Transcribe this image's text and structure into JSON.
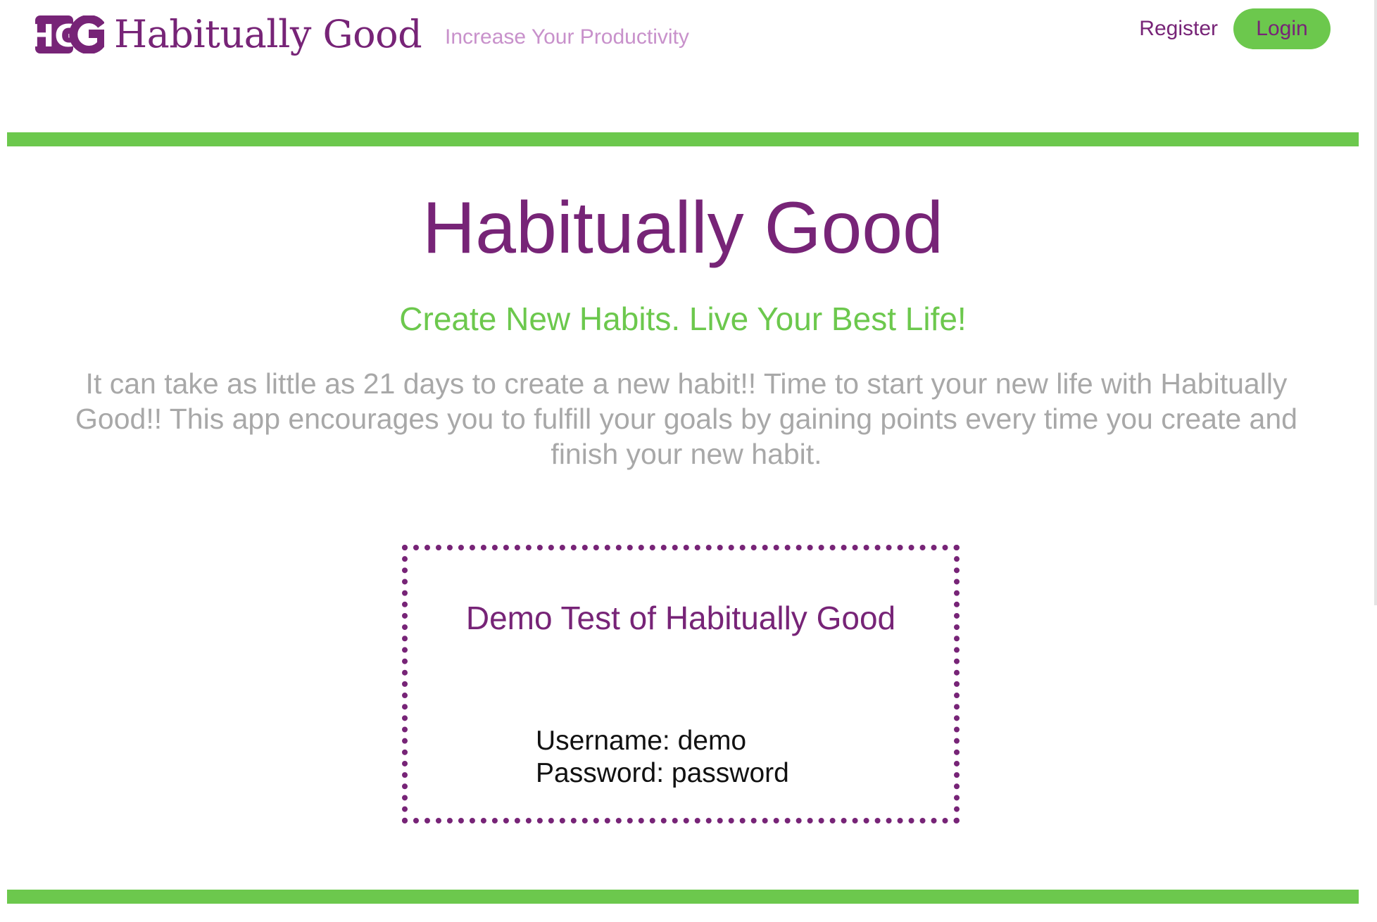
{
  "header": {
    "logo_text": "HG",
    "brand_name": "Habitually Good",
    "tagline": "Increase Your Productivity",
    "nav": {
      "register_label": "Register",
      "login_label": "Login"
    }
  },
  "hero": {
    "title": "Habitually Good",
    "subtitle": "Create New Habits. Live Your Best Life!",
    "description": "It can take as little as 21 days to create a new habit!! Time to start your new life with Habitually Good!! This app encourages you to fulfill your goals by gaining points every time you create and finish your new habit."
  },
  "demo": {
    "title": "Demo Test of Habitually Good",
    "username_line": "Username: demo",
    "password_line": "Password: password"
  },
  "colors": {
    "brand_purple": "#772477",
    "accent_green": "#6cc84d",
    "tagline_lilac": "#c891cb",
    "body_gray": "#a8a8a8"
  },
  "icons": {
    "logo": "hg-monogram-icon"
  }
}
